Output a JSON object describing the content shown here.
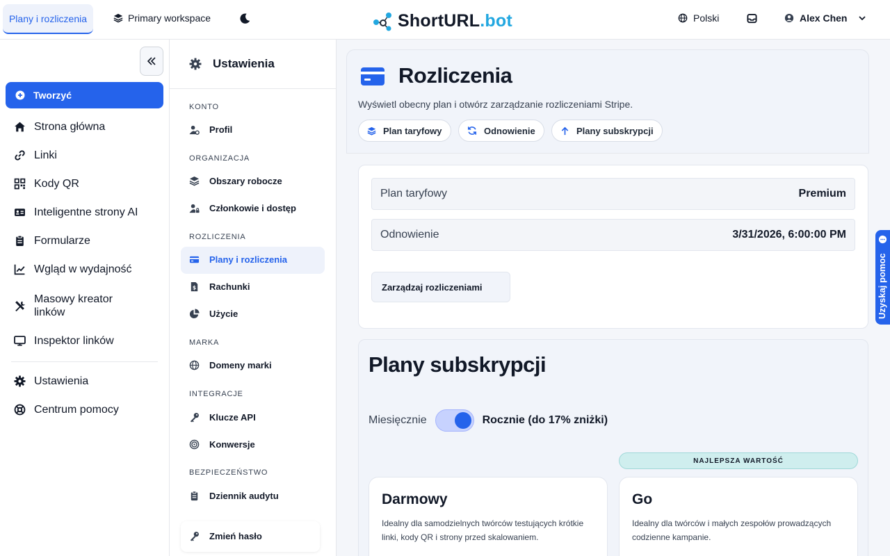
{
  "topbar": {
    "active_tab": "Plany i rozliczenia",
    "workspace": "Primary workspace",
    "logo_main": "ShortURL",
    "logo_accent": ".bot",
    "language": "Polski",
    "user_name": "Alex Chen"
  },
  "sidebar": {
    "create_label": "Tworzyć",
    "items": [
      {
        "label": "Strona główna",
        "icon": "home-icon"
      },
      {
        "label": "Linki",
        "icon": "link-icon"
      },
      {
        "label": "Kody QR",
        "icon": "qr-icon"
      },
      {
        "label": "Inteligentne strony AI",
        "icon": "id-card-icon"
      },
      {
        "label": "Formularze",
        "icon": "clipboard-icon"
      },
      {
        "label": "Wgląd w wydajność",
        "icon": "chart-line-icon"
      },
      {
        "label": "Masowy kreator linków",
        "icon": "tools-icon"
      },
      {
        "label": "Inspektor linków",
        "icon": "monitor-icon"
      },
      {
        "label": "Ustawienia",
        "icon": "gear-icon"
      },
      {
        "label": "Centrum pomocy",
        "icon": "lifebuoy-icon"
      }
    ]
  },
  "settings": {
    "title": "Ustawienia",
    "sections": {
      "account": "KONTO",
      "organization": "ORGANIZACJA",
      "billing": "ROZLICZENIA",
      "brand": "MARKA",
      "integrations": "INTEGRACJE",
      "security": "BEZPIECZEŃSTWO"
    },
    "items": {
      "profile": "Profil",
      "workspaces": "Obszary robocze",
      "members": "Członkowie i dostęp",
      "plans": "Plany i rozliczenia",
      "invoices": "Rachunki",
      "usage": "Użycie",
      "domains": "Domeny marki",
      "api_keys": "Klucze API",
      "conversions": "Konwersje",
      "audit_log": "Dziennik audytu",
      "change_password": "Zmień hasło"
    }
  },
  "billing": {
    "title": "Rozliczenia",
    "subtitle": "Wyświetl obecny plan i otwórz zarządzanie rozliczeniami Stripe.",
    "pills": [
      "Plan taryfowy",
      "Odnowienie",
      "Plany subskrypcji"
    ],
    "plan_label": "Plan taryfowy",
    "plan_value": "Premium",
    "renewal_label": "Odnowienie",
    "renewal_value": "3/31/2026, 6:00:00 PM",
    "manage_label": "Zarządzaj rozliczeniami"
  },
  "plans": {
    "title": "Plany subskrypcji",
    "monthly": "Miesięcznie",
    "yearly": "Rocznie (do 17% zniżki)",
    "yearly_selected": true,
    "best_value_badge": "NAJLEPSZA WARTOŚĆ",
    "cards": [
      {
        "name": "Darmowy",
        "description": "Idealny dla samodzielnych twórców testujących krótkie linki, kody QR i strony przed skalowaniem."
      },
      {
        "name": "Go",
        "description": "Idealny dla twórców i małych zespołów prowadzących codzienne kampanie."
      }
    ]
  },
  "help": {
    "label": "Uzyskaj pomoc"
  },
  "colors": {
    "accent": "#2563eb",
    "logo_accent": "#22a7e0",
    "badge_bg": "#cfeeee"
  }
}
